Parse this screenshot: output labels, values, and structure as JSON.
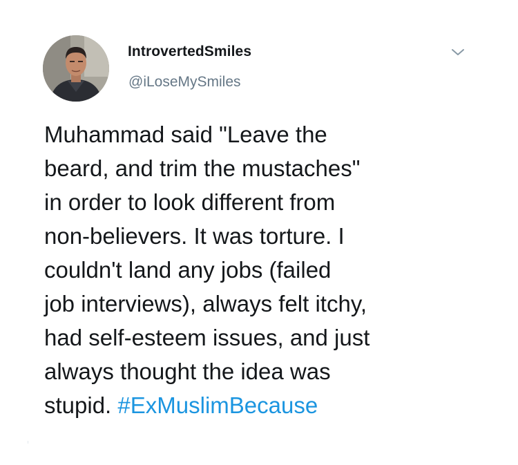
{
  "tweet": {
    "author": {
      "display_name": "IntrovertedSmiles",
      "handle": "@iLoseMySmiles",
      "avatar_icon": "user-avatar-photo"
    },
    "menu_icon": "chevron-down-icon",
    "text_lines": [
      "Muhammad said \"Leave the",
      "beard, and trim the mustaches\"",
      "in order to look different from",
      "non-believers. It was torture. I",
      "couldn't land any jobs (failed",
      "job interviews), always felt itchy,",
      "had self-esteem issues, and just",
      "always thought the idea was"
    ],
    "last_line_text": "stupid. ",
    "hashtag": "#ExMuslimBecause"
  },
  "colors": {
    "text": "#14171a",
    "handle": "#657786",
    "hashtag": "#1b95e0",
    "caret": "#8899a6"
  }
}
